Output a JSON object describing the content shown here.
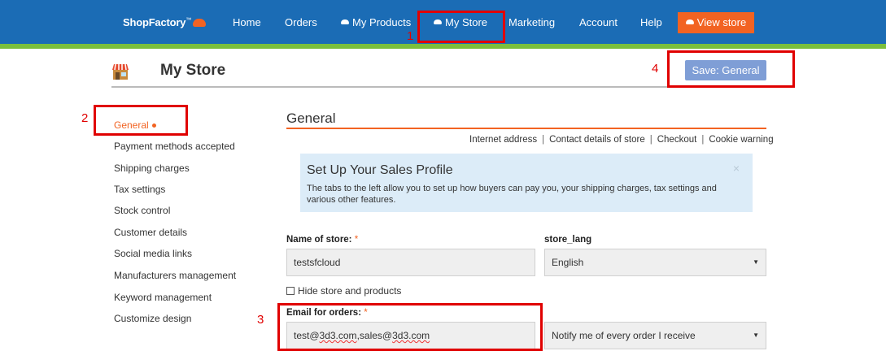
{
  "brand": {
    "name": "ShopFactory",
    "mark": "™"
  },
  "nav": {
    "items": [
      {
        "label": "Home"
      },
      {
        "label": "Orders"
      },
      {
        "label": "My Products"
      },
      {
        "label": "My Store"
      },
      {
        "label": "Marketing"
      },
      {
        "label": "Account"
      },
      {
        "label": "Help"
      }
    ],
    "view_store": "View store"
  },
  "header": {
    "title": "My Store",
    "save_label": "Save: General"
  },
  "sidebar": {
    "items": [
      {
        "label": "General"
      },
      {
        "label": "Payment methods accepted"
      },
      {
        "label": "Shipping charges"
      },
      {
        "label": "Tax settings"
      },
      {
        "label": "Stock control"
      },
      {
        "label": "Customer details"
      },
      {
        "label": "Social media links"
      },
      {
        "label": "Manufacturers management"
      },
      {
        "label": "Keyword management"
      },
      {
        "label": "Customize design"
      }
    ]
  },
  "main": {
    "section_title": "General",
    "subnav": [
      "Internet address",
      "Contact details of store",
      "Checkout",
      "Cookie warning"
    ],
    "info": {
      "title": "Set Up Your Sales Profile",
      "text": "The tabs to the left allow you to set up how buyers can pay you, your shipping charges, tax settings and various other features.",
      "close": "×"
    },
    "store_name": {
      "label": "Name of store:",
      "required": "*",
      "value": "testsfcloud"
    },
    "store_lang": {
      "label": "store_lang",
      "value": "English"
    },
    "hide_store": {
      "label": "Hide store and products",
      "checked": false
    },
    "email": {
      "label": "Email for orders:",
      "required": "*",
      "value_part1": "test@",
      "value_part2": "3d3.com",
      "value_part3": ",sales@",
      "value_part4": "3d3.com"
    },
    "notify": {
      "value": "Notify me of every order I receive"
    }
  },
  "annotations": {
    "n1": "1",
    "n2": "2",
    "n3": "3",
    "n4": "4"
  },
  "colors": {
    "nav_bg": "#1b6cb5",
    "accent_orange": "#f26322",
    "green_strip": "#7bbf3c",
    "save_button": "#7f9ed6",
    "info_bg": "#dcecf8",
    "annotation_red": "#e00000"
  }
}
